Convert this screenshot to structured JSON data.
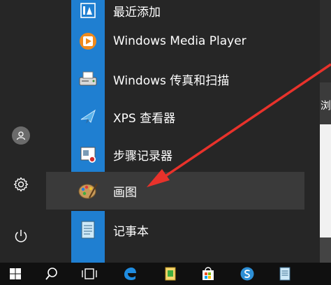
{
  "apps": [
    {
      "label": "最近添加",
      "icon": "recently-added-icon"
    },
    {
      "label": "Windows Media Player",
      "icon": "media-player-icon"
    },
    {
      "label": "Windows 传真和扫描",
      "icon": "fax-scan-icon"
    },
    {
      "label": "XPS 查看器",
      "icon": "xps-viewer-icon"
    },
    {
      "label": "步骤记录器",
      "icon": "steps-recorder-icon"
    },
    {
      "label": "画图",
      "icon": "paint-icon",
      "selected": true
    },
    {
      "label": "记事本",
      "icon": "notepad-icon"
    }
  ],
  "right_edge_text": "浏",
  "colors": {
    "accent_tile": "#1f7fd1",
    "background": "#262626",
    "taskbar": "#101010",
    "arrow": "#e8322b"
  }
}
